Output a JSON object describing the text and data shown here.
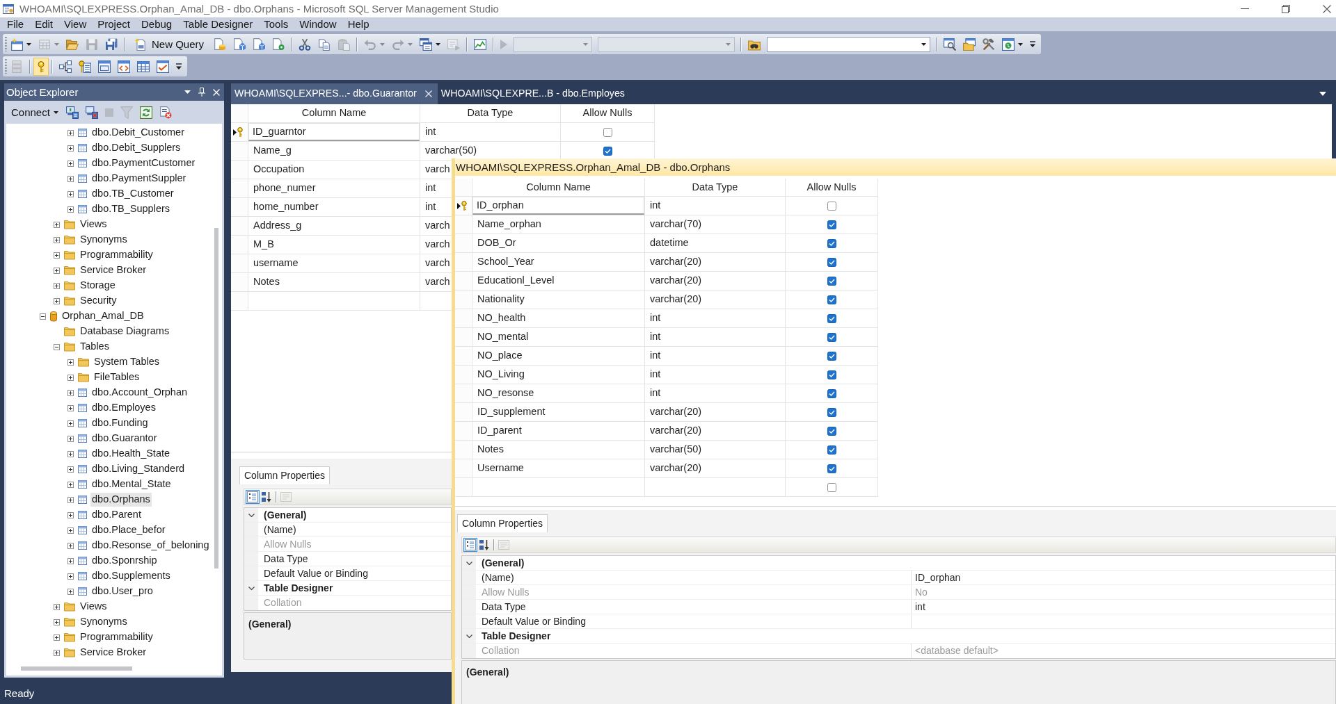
{
  "window": {
    "title": "WHOAMI\\SQLEXPRESS.Orphan_Amal_DB - dbo.Orphans - Microsoft SQL Server Management Studio"
  },
  "menu": [
    "File",
    "Edit",
    "View",
    "Project",
    "Debug",
    "Table Designer",
    "Tools",
    "Window",
    "Help"
  ],
  "standard_toolbar": [
    [
      {
        "kind": "button",
        "disabled": false,
        "dropdown": true
      },
      {
        "kind": "button",
        "disabled": true,
        "dropdown": true
      },
      {
        "kind": "button",
        "disabled": false
      },
      {
        "kind": "button",
        "disabled": true
      },
      {
        "kind": "button",
        "disabled": false
      }
    ],
    [
      {
        "kind": "button",
        "label": "New Query",
        "disabled": false
      },
      {
        "kind": "button",
        "disabled": false
      },
      {
        "kind": "button",
        "disabled": false
      },
      {
        "kind": "button",
        "disabled": false
      },
      {
        "kind": "button",
        "disabled": false
      }
    ],
    [
      {
        "kind": "button",
        "disabled": false
      },
      {
        "kind": "button",
        "disabled": false
      },
      {
        "kind": "button",
        "disabled": true
      }
    ],
    [
      {
        "kind": "button",
        "disabled": true,
        "dropdown": true
      },
      {
        "kind": "button",
        "disabled": true,
        "dropdown": true
      },
      {
        "kind": "button",
        "disabled": false,
        "dropdown": true
      },
      {
        "kind": "button",
        "disabled": true
      }
    ],
    [
      {
        "kind": "button",
        "disabled": false
      }
    ],
    [
      {
        "kind": "button",
        "disabled": true
      },
      {
        "kind": "combo",
        "disabled": true
      },
      {
        "kind": "combo",
        "disabled": true
      }
    ],
    [
      {
        "kind": "button",
        "disabled": false
      },
      {
        "kind": "combo",
        "disabled": false
      }
    ],
    [
      {
        "kind": "button",
        "disabled": false
      },
      {
        "kind": "button",
        "disabled": false
      },
      {
        "kind": "button",
        "disabled": false
      },
      {
        "kind": "button",
        "disabled": false,
        "dropdown": true
      }
    ]
  ],
  "designer_toolbar": [
    [
      {
        "kind": "button",
        "disabled": true,
        "pressed": false
      }
    ],
    [
      {
        "kind": "button",
        "disabled": false,
        "pressed": true
      }
    ],
    [
      {
        "kind": "button",
        "disabled": false,
        "pressed": false
      },
      {
        "kind": "button",
        "disabled": false,
        "pressed": false
      },
      {
        "kind": "button",
        "disabled": false,
        "pressed": false
      },
      {
        "kind": "button",
        "disabled": false,
        "pressed": false
      },
      {
        "kind": "button",
        "disabled": false,
        "pressed": false
      },
      {
        "kind": "button",
        "disabled": false,
        "pressed": false
      }
    ]
  ],
  "object_explorer": {
    "title": "Object Explorer",
    "toolbar": [
      [
        {
          "kind": "text",
          "label": "Connect",
          "dropdown": true,
          "disabled": false
        },
        {
          "kind": "button",
          "disabled": false
        },
        {
          "kind": "button",
          "disabled": false
        },
        {
          "kind": "button",
          "disabled": true
        },
        {
          "kind": "button",
          "disabled": true
        },
        {
          "kind": "button",
          "disabled": false
        },
        {
          "kind": "button",
          "disabled": false
        }
      ]
    ],
    "tree": [
      {
        "children": [
          {
            "children": [
              {
                "label": "dbo.Debit_Customer",
                "kind": "table",
                "expanded": false,
                "selected": false
              },
              {
                "label": "dbo.Debit_Supplers",
                "kind": "table",
                "expanded": false,
                "selected": false
              },
              {
                "label": "dbo.PaymentCustomer",
                "kind": "table",
                "expanded": false,
                "selected": false
              },
              {
                "label": "dbo.PaymentSuppler",
                "kind": "table",
                "expanded": false,
                "selected": false
              },
              {
                "label": "dbo.TB_Customer",
                "kind": "table",
                "expanded": false,
                "selected": false
              },
              {
                "label": "dbo.TB_Supplers",
                "kind": "table",
                "expanded": false,
                "selected": false
              }
            ]
          },
          {
            "label": "Views",
            "kind": "folder",
            "expanded": false,
            "selected": false
          },
          {
            "label": "Synonyms",
            "kind": "folder",
            "expanded": false,
            "selected": false
          },
          {
            "label": "Programmability",
            "kind": "folder",
            "expanded": false,
            "selected": false
          },
          {
            "label": "Service Broker",
            "kind": "folder",
            "expanded": false,
            "selected": false
          },
          {
            "label": "Storage",
            "kind": "folder",
            "expanded": false,
            "selected": false
          },
          {
            "label": "Security",
            "kind": "folder",
            "expanded": false,
            "selected": false
          }
        ]
      },
      {
        "label": "Orphan_Amal_DB",
        "kind": "database",
        "expanded": true,
        "selected": false,
        "children": [
          {
            "label": "Database Diagrams",
            "kind": "folder",
            "selected": false
          },
          {
            "label": "Tables",
            "kind": "folder",
            "expanded": true,
            "selected": false,
            "children": [
              {
                "label": "System Tables",
                "kind": "folder",
                "expanded": false,
                "selected": false
              },
              {
                "label": "FileTables",
                "kind": "folder",
                "expanded": false,
                "selected": false
              },
              {
                "label": "dbo.Account_Orphan",
                "kind": "table",
                "expanded": false,
                "selected": false
              },
              {
                "label": "dbo.Employes",
                "kind": "table",
                "expanded": false,
                "selected": false
              },
              {
                "label": "dbo.Funding",
                "kind": "table",
                "expanded": false,
                "selected": false
              },
              {
                "label": "dbo.Guarantor",
                "kind": "table",
                "expanded": false,
                "selected": false
              },
              {
                "label": "dbo.Health_State",
                "kind": "table",
                "expanded": false,
                "selected": false
              },
              {
                "label": "dbo.Living_Standerd",
                "kind": "table",
                "expanded": false,
                "selected": false
              },
              {
                "label": "dbo.Mental_State",
                "kind": "table",
                "expanded": false,
                "selected": false
              },
              {
                "label": "dbo.Orphans",
                "kind": "table",
                "expanded": false,
                "selected": true
              },
              {
                "label": "dbo.Parent",
                "kind": "table",
                "expanded": false,
                "selected": false
              },
              {
                "label": "dbo.Place_befor",
                "kind": "table",
                "expanded": false,
                "selected": false
              },
              {
                "label": "dbo.Resonse_of_beloning",
                "kind": "table",
                "expanded": false,
                "selected": false
              },
              {
                "label": "dbo.Sponrship",
                "kind": "table",
                "expanded": false,
                "selected": false
              },
              {
                "label": "dbo.Supplements",
                "kind": "table",
                "expanded": false,
                "selected": false
              },
              {
                "label": "dbo.User_pro",
                "kind": "table",
                "expanded": false,
                "selected": false
              }
            ]
          },
          {
            "label": "Views",
            "kind": "folder",
            "expanded": false,
            "selected": false
          },
          {
            "label": "Synonyms",
            "kind": "folder",
            "expanded": false,
            "selected": false
          },
          {
            "label": "Programmability",
            "kind": "folder",
            "expanded": false,
            "selected": false
          },
          {
            "label": "Service Broker",
            "kind": "folder",
            "expanded": false,
            "selected": false
          }
        ]
      }
    ]
  },
  "document_tabs": [
    {
      "label": "WHOAMI\\SQLEXPRES...- dbo.Guarantor",
      "selected": true
    },
    {
      "label": "WHOAMI\\SQLEXPRE...B - dbo.Employes",
      "selected": false
    }
  ],
  "document": {
    "columns": [
      "Column Name",
      "Data Type",
      "Allow Nulls"
    ],
    "rows": [
      {
        "name": "ID_guarntor",
        "type": "int",
        "allow_nulls": false,
        "primary_key": true,
        "selected": true
      },
      {
        "name": "Name_g",
        "type": "varchar(50)",
        "allow_nulls": true,
        "primary_key": false,
        "selected": false
      },
      {
        "name": "Occupation",
        "type": "varch",
        "primary_key": false,
        "selected": false
      },
      {
        "name": "phone_numer",
        "type": "int",
        "primary_key": false,
        "selected": false
      },
      {
        "name": "home_number",
        "type": "int",
        "primary_key": false,
        "selected": false
      },
      {
        "name": "Address_g",
        "type": "varch",
        "primary_key": false,
        "selected": false
      },
      {
        "name": "M_B",
        "type": "varch",
        "primary_key": false,
        "selected": false
      },
      {
        "name": "username",
        "type": "varch",
        "primary_key": false,
        "selected": false
      },
      {
        "name": "Notes",
        "type": "varch",
        "primary_key": false,
        "selected": false
      },
      {
        "primary_key": false,
        "selected": false
      }
    ],
    "properties": {
      "tab": "Column Properties",
      "toolbar": [
        [
          {
            "kind": "button",
            "pressed": true,
            "disabled": false
          },
          {
            "kind": "button",
            "pressed": false,
            "disabled": false
          }
        ],
        [
          {
            "kind": "button",
            "pressed": false,
            "disabled": true
          }
        ]
      ],
      "rows": [
        {
          "kind": "category",
          "label": "(General)",
          "expanded": true
        },
        {
          "kind": "property",
          "label": "(Name)",
          "disabled": false
        },
        {
          "kind": "property",
          "label": "Allow Nulls",
          "disabled": true
        },
        {
          "kind": "property",
          "label": "Data Type",
          "disabled": false
        },
        {
          "kind": "property",
          "label": "Default Value or Binding",
          "disabled": false
        },
        {
          "kind": "category",
          "label": "Table Designer",
          "expanded": true
        },
        {
          "kind": "property",
          "label": "Collation",
          "disabled": true
        }
      ],
      "description": "(General)"
    }
  },
  "floating_document": {
    "title": "WHOAMI\\SQLEXPRESS.Orphan_Amal_DB - dbo.Orphans",
    "columns": [
      "Column Name",
      "Data Type",
      "Allow Nulls"
    ],
    "rows": [
      {
        "name": "ID_orphan",
        "type": "int",
        "allow_nulls": false,
        "primary_key": true,
        "selected": true
      },
      {
        "name": "Name_orphan",
        "type": "varchar(70)",
        "allow_nulls": true,
        "primary_key": false,
        "selected": false
      },
      {
        "name": "DOB_Or",
        "type": "datetime",
        "allow_nulls": true,
        "primary_key": false,
        "selected": false
      },
      {
        "name": "School_Year",
        "type": "varchar(20)",
        "allow_nulls": true,
        "primary_key": false,
        "selected": false
      },
      {
        "name": "Educationl_Level",
        "type": "varchar(20)",
        "allow_nulls": true,
        "primary_key": false,
        "selected": false
      },
      {
        "name": "Nationality",
        "type": "varchar(20)",
        "allow_nulls": true,
        "primary_key": false,
        "selected": false
      },
      {
        "name": "NO_health",
        "type": "int",
        "allow_nulls": true,
        "primary_key": false,
        "selected": false
      },
      {
        "name": "NO_mental",
        "type": "int",
        "allow_nulls": true,
        "primary_key": false,
        "selected": false
      },
      {
        "name": "NO_place",
        "type": "int",
        "allow_nulls": true,
        "primary_key": false,
        "selected": false
      },
      {
        "name": "NO_Living",
        "type": "int",
        "allow_nulls": true,
        "primary_key": false,
        "selected": false
      },
      {
        "name": "NO_resonse",
        "type": "int",
        "allow_nulls": true,
        "primary_key": false,
        "selected": false
      },
      {
        "name": "ID_supplement",
        "type": "varchar(20)",
        "allow_nulls": true,
        "primary_key": false,
        "selected": false
      },
      {
        "name": "ID_parent",
        "type": "varchar(20)",
        "allow_nulls": true,
        "primary_key": false,
        "selected": false
      },
      {
        "name": "Notes",
        "type": "varchar(50)",
        "allow_nulls": true,
        "primary_key": false,
        "selected": false
      },
      {
        "name": "Username",
        "type": "varchar(20)",
        "allow_nulls": true,
        "primary_key": false,
        "selected": false
      },
      {
        "allow_nulls": false,
        "primary_key": false,
        "selected": false
      }
    ],
    "properties": {
      "tab": "Column Properties",
      "toolbar": [
        [
          {
            "kind": "button",
            "pressed": true,
            "disabled": false
          },
          {
            "kind": "button",
            "pressed": false,
            "disabled": false
          }
        ],
        [
          {
            "kind": "button",
            "pressed": false,
            "disabled": true
          }
        ]
      ],
      "rows": [
        {
          "kind": "category",
          "label": "(General)",
          "expanded": true
        },
        {
          "kind": "property",
          "label": "(Name)",
          "value": "ID_orphan",
          "disabled": false
        },
        {
          "kind": "property",
          "label": "Allow Nulls",
          "value": "No",
          "disabled": true
        },
        {
          "kind": "property",
          "label": "Data Type",
          "value": "int",
          "disabled": false
        },
        {
          "kind": "property",
          "label": "Default Value or Binding",
          "disabled": false
        },
        {
          "kind": "category",
          "label": "Table Designer",
          "expanded": true
        },
        {
          "kind": "property",
          "label": "Collation",
          "value": "<database default>",
          "disabled": true
        }
      ],
      "description": "(General)"
    }
  },
  "status_bar": {
    "text": "Ready"
  }
}
